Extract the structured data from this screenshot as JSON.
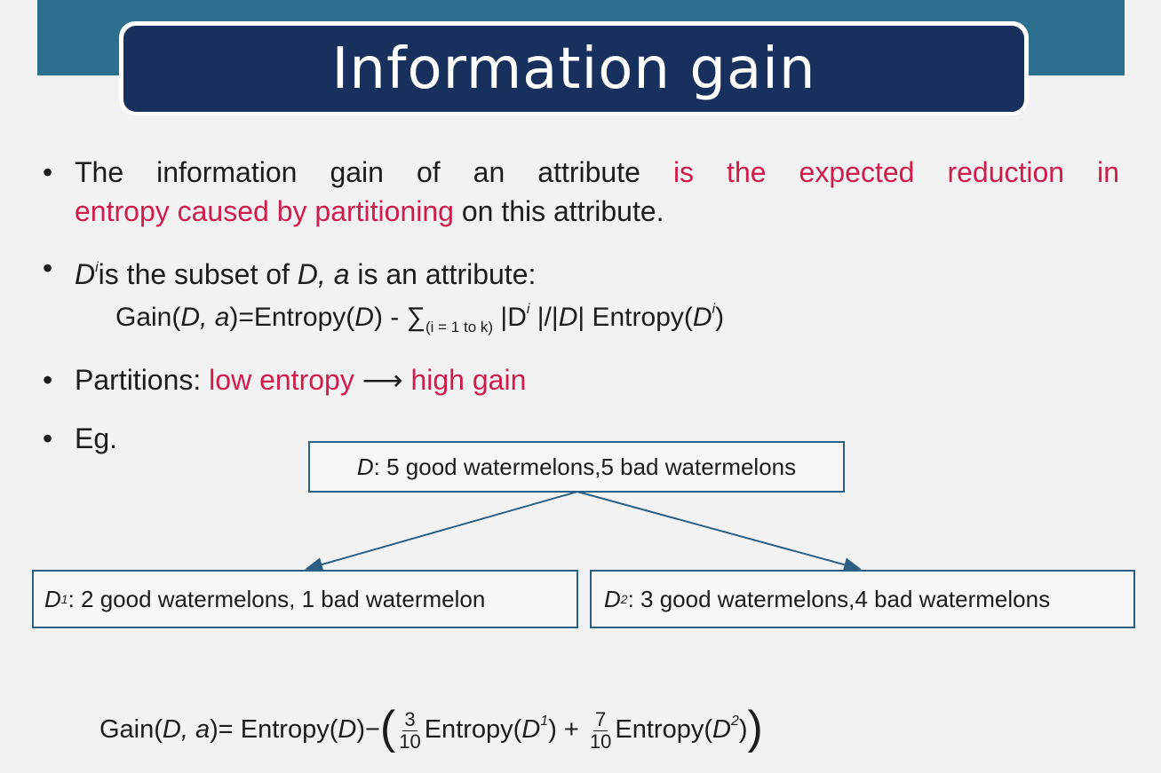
{
  "slide": {
    "title": "Information gain",
    "bullets": [
      {
        "line1_normal": "The information gain of an attribute ",
        "line1_red": "is the expected reduction in",
        "line2_red": "entropy caused by partitioning",
        "line2_normal": " on this attribute."
      },
      {
        "di": "D",
        "di_sup": "i",
        "rest1": "is the subset of ",
        "d": "D,",
        "a": "a",
        "rest2": " is an attribute:"
      },
      {
        "label": "Partitions: ",
        "low": "low entropy",
        "arrow": "⟶",
        "high": "high gain"
      },
      {
        "label": "Eg."
      }
    ],
    "gain_formula": {
      "prefix": "Gain(",
      "d": "D, a",
      "mid": ")=Entropy(",
      "d2": "D",
      "mid2": ") - ∑",
      "sub": "(i = 1 to k)",
      "abs1": " |D",
      "sup1": "i",
      "abs2": " |/|",
      "d3": "D",
      "abs3": "| Entropy(",
      "d4": "D",
      "sup2": "i",
      "end": ")"
    },
    "tree": {
      "root": {
        "d": "D",
        "text": ": 5 good watermelons,5 bad watermelons"
      },
      "left": {
        "d": "D",
        "sup": "1",
        "text": ": 2 good watermelons, 1 bad watermelon"
      },
      "right": {
        "d": "D",
        "sup": "2",
        "text": ": 3 good watermelons,4 bad watermelons"
      }
    },
    "example_formula": {
      "prefix": "Gain(",
      "d": "D, a",
      "mid": ")= Entropy(",
      "d2": "D",
      "minus": ")−",
      "frac1_num": "3",
      "frac1_den": "10",
      "ent1": "Entropy(",
      "d3": "D",
      "sup1": "1",
      "plus": ") + ",
      "frac2_num": "7",
      "frac2_den": "10",
      "ent2": "Entropy(",
      "d4": "D",
      "sup2": "2",
      "end": ")"
    }
  }
}
